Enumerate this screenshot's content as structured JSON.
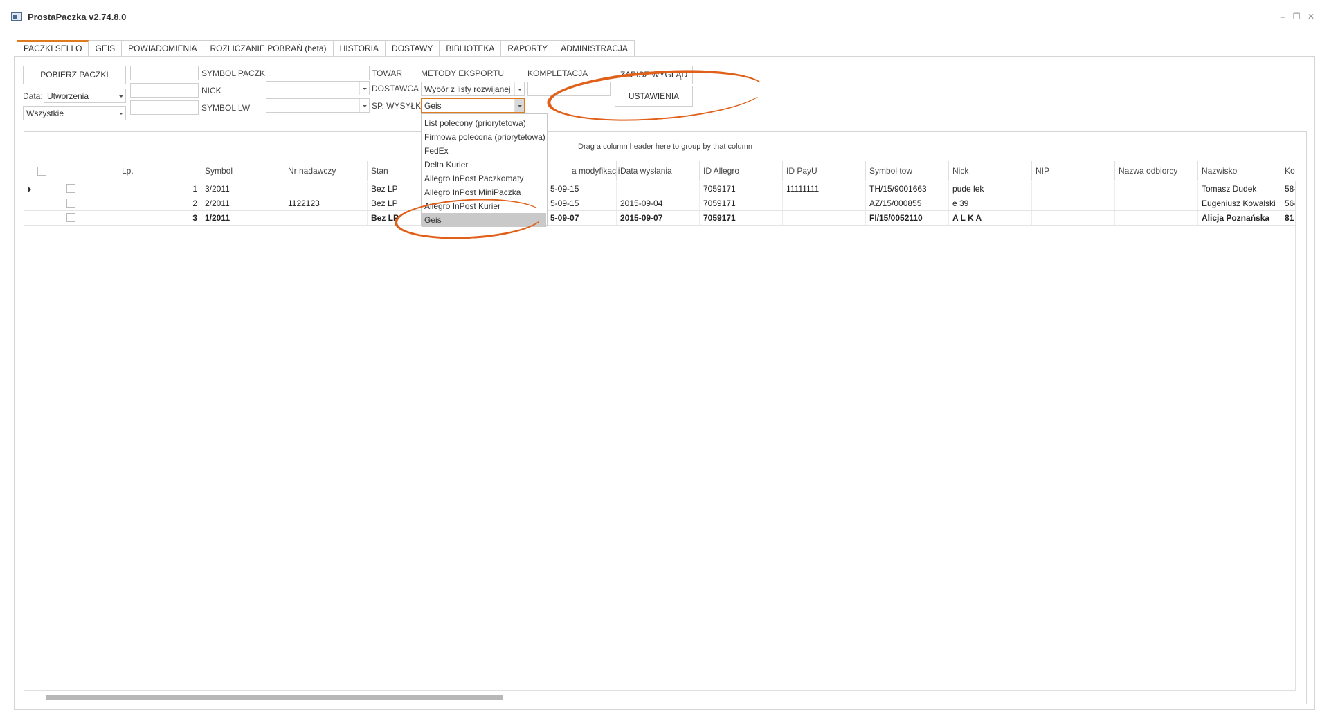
{
  "app": {
    "title": "ProstaPaczka v2.74.8.0"
  },
  "window_controls": {
    "minimize": "–",
    "restore": "❐",
    "close": "✕"
  },
  "tabs": [
    {
      "label": "PACZKI SELLO",
      "active": true
    },
    {
      "label": "GEIS"
    },
    {
      "label": "POWIADOMIENIA"
    },
    {
      "label": "ROZLICZANIE POBRAŃ (beta)"
    },
    {
      "label": "HISTORIA"
    },
    {
      "label": "DOSTAWY"
    },
    {
      "label": "BIBLIOTEKA"
    },
    {
      "label": "RAPORTY"
    },
    {
      "label": "ADMINISTRACJA"
    }
  ],
  "filters": {
    "pobierz_button": "POBIERZ PACZKI",
    "date_label": "Data:",
    "date_value": "Utworzenia",
    "status_value": "Wszystkie",
    "symbol_paczki_label": "SYMBOL PACZKI",
    "nick_label": "NICK",
    "symbol_lw_label": "SYMBOL LW",
    "towar_label": "TOWAR",
    "dostawca_label": "DOSTAWCA",
    "sp_wysylki_label": "SP. WYSYŁKI",
    "metody_label": "METODY EKSPORTU",
    "metody_value": "Wybór z listy rozwijanej",
    "sp_wysylki_value": "Geis",
    "kompletacja_label": "KOMPLETACJA",
    "zapisz_button": "ZAPISZ WYGLĄD",
    "ustawienia_button": "USTAWIENIA"
  },
  "dropdown": {
    "items": [
      "List polecony (priorytetowa)",
      "Firmowa polecona (priorytetowa)",
      "FedEx",
      "Delta Kurier",
      "Allegro InPost Paczkomaty",
      "Allegro InPost MiniPaczka",
      "Allegro InPost Kurier",
      "Geis"
    ],
    "selected": "Geis"
  },
  "grid": {
    "group_panel_text": "Drag a column header here to group by that column",
    "columns": [
      "Lp.",
      "Symbol",
      "Nr nadawczy",
      "Stan",
      "a modyfikacji",
      "Data wysłania",
      "ID Allegro",
      "ID PayU",
      "Symbol tow",
      "Nick",
      "NIP",
      "Nazwa odbiorcy",
      "Nazwisko",
      "Ko"
    ],
    "rows": [
      {
        "lp": "1",
        "symbol": "3/2011",
        "nr_nadawczy": "",
        "stan": "Bez LP",
        "data_mod": "5-09-15",
        "data_wysl": "",
        "id_allegro": "7059171",
        "id_payu": "11111111",
        "symbol_tow": "TH/15/9001663",
        "nick": "pude lek",
        "nip": "",
        "nazwa": "",
        "nazwisko": "Tomasz Dudek",
        "ko": "58-"
      },
      {
        "lp": "2",
        "symbol": "2/2011",
        "nr_nadawczy": "1122123",
        "stan": "Bez LP",
        "data_mod": "5-09-15",
        "data_wysl": "2015-09-04",
        "id_allegro": "7059171",
        "id_payu": "",
        "symbol_tow": "AZ/15/000855",
        "nick": "e 39",
        "nip": "",
        "nazwa": "",
        "nazwisko": "Eugeniusz Kowalski",
        "ko": "56-"
      },
      {
        "lp": "3",
        "symbol": "1/2011",
        "nr_nadawczy": "",
        "stan": "Bez LP",
        "data_mod": "5-09-07",
        "data_wysl": "2015-09-07",
        "id_allegro": "7059171",
        "id_payu": "",
        "symbol_tow": "FI/15/0052110",
        "nick": "A L K A",
        "nip": "",
        "nazwa": "",
        "nazwisko": "Alicja Poznańska",
        "ko": "81"
      }
    ]
  },
  "colors": {
    "accent": "#e07a1f",
    "annotation": "#e0601a",
    "selection": "#c9c9c9"
  },
  "icons": [
    "app-window-icon",
    "chevron-down-icon",
    "row-indicator-icon"
  ]
}
